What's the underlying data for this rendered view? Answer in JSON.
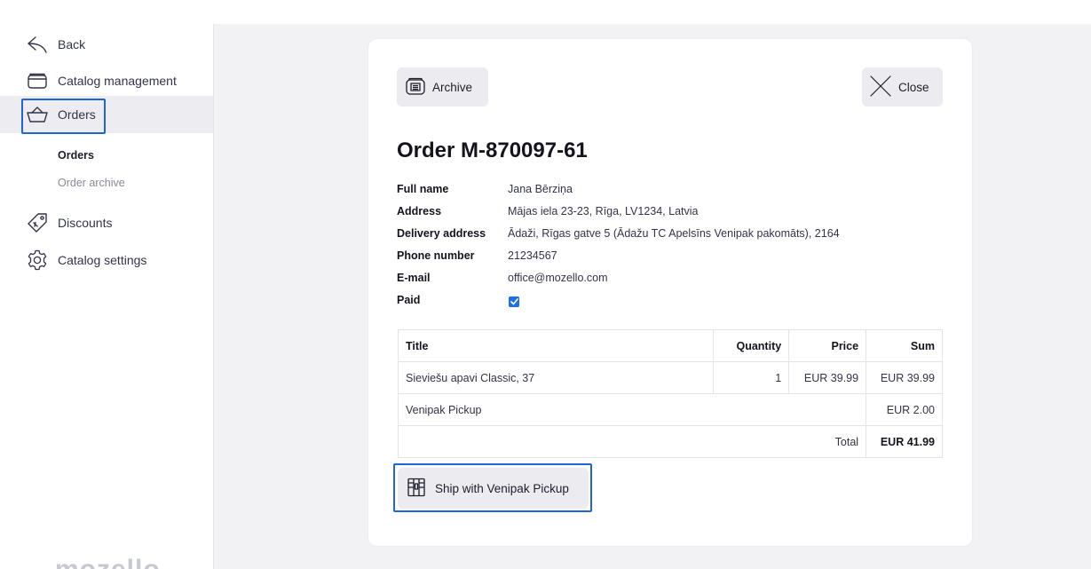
{
  "sidebar": {
    "back_label": "Back",
    "catalog_management_label": "Catalog management",
    "orders_label": "Orders",
    "sub_orders_label": "Orders",
    "sub_archive_label": "Order archive",
    "discounts_label": "Discounts",
    "catalog_settings_label": "Catalog settings",
    "logo_text": "mozello"
  },
  "order": {
    "archive_label": "Archive",
    "close_label": "Close",
    "title": "Order M-870097-61",
    "details": {
      "full_name_label": "Full name",
      "full_name": "Jana Bērziņa",
      "address_label": "Address",
      "address": "Mājas iela 23-23, Rīga, LV1234, Latvia",
      "delivery_label": "Delivery address",
      "delivery": "Ādaži, Rīgas gatve 5 (Ādažu TC Apelsīns Venipak pakomāts), 2164",
      "phone_label": "Phone number",
      "phone": "21234567",
      "email_label": "E-mail",
      "email": "office@mozello.com",
      "paid_label": "Paid",
      "paid": true
    },
    "table": {
      "headers": {
        "title": "Title",
        "quantity": "Quantity",
        "price": "Price",
        "sum": "Sum"
      },
      "rows": [
        {
          "title": "Sieviešu apavi Classic, 37",
          "quantity": "1",
          "price": "EUR 39.99",
          "sum": "EUR 39.99"
        }
      ],
      "shipping": {
        "title": "Venipak Pickup",
        "sum": "EUR 2.00"
      },
      "total_label": "Total",
      "total": "EUR 41.99"
    },
    "ship_label": "Ship with Venipak Pickup"
  },
  "colors": {
    "accent": "#2064d8",
    "checkbox": "#1f6fe5",
    "button_bg": "#ececf0",
    "active_nav_bg": "#ededf1"
  },
  "icons": {
    "back": "back-arrow-icon",
    "catalog": "folder-icon",
    "orders": "basket-icon",
    "discounts": "tag-icon",
    "settings": "gear-icon",
    "archive": "archive-box-icon",
    "close": "close-icon",
    "ship": "parcel-locker-icon"
  }
}
